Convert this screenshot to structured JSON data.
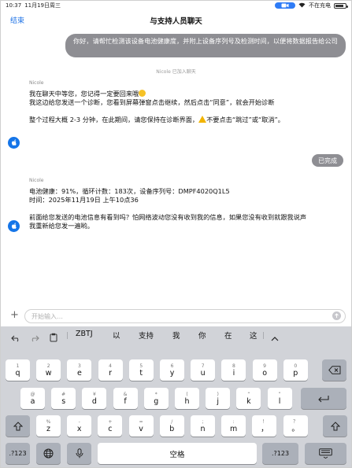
{
  "status_bar": {
    "time": "10:37",
    "date": "11月19日周三",
    "charge_label": "不在充电"
  },
  "header": {
    "end_label": "结束",
    "title": "与支持人员聊天"
  },
  "messages": {
    "user_request": "你好，请帮忙检测该设备电池健康度，并附上设备序列号及检测时间，以便将数据报告给公司",
    "system_note": "Nicole 已加入聊天",
    "agent_name_1": "Nicole",
    "agent_msg_1_line_1_before": "我在聊天中等您，您记得一定要回来哦",
    "agent_msg_1_line_2": "我这边给您发送一个诊断，您看到屏幕弹窗点击继续，然后点击“同意”，就会开始诊断",
    "agent_msg_1_line_3_before": "整个过程大概 2-3 分钟，在此期间，请您保持在诊断界面，",
    "agent_msg_1_line_3_after": "不要点击“跳过”或“取消”。",
    "user_done": "已完成",
    "agent_name_2": "Nicole",
    "agent_msg_2_line_1": "电池健康：91%，循环计数：183次，设备序列号：DMPF4020Q1L5",
    "agent_msg_2_line_2": "时间：2025年11月19日 上午10点36",
    "agent_msg_2_line_3": "前面给您发送的电池信息有看到吗？怕网络波动您没有收到我的信息，如果您没有收到就跟我说声我重新给您发一遍哟。"
  },
  "input": {
    "placeholder": "开始输入…"
  },
  "keyboard": {
    "suggestions": [
      "ZBTJ",
      "以",
      "支持",
      "我",
      "你",
      "在",
      "这"
    ],
    "row1": [
      {
        "main": "q",
        "top": "1"
      },
      {
        "main": "w",
        "top": "2"
      },
      {
        "main": "e",
        "top": "3"
      },
      {
        "main": "r",
        "top": "4"
      },
      {
        "main": "t",
        "top": "5"
      },
      {
        "main": "y",
        "top": "6"
      },
      {
        "main": "u",
        "top": "7"
      },
      {
        "main": "i",
        "top": "8"
      },
      {
        "main": "o",
        "top": "9"
      },
      {
        "main": "p",
        "top": "0"
      }
    ],
    "row2": [
      {
        "main": "a",
        "top": "@"
      },
      {
        "main": "s",
        "top": "#"
      },
      {
        "main": "d",
        "top": "¥"
      },
      {
        "main": "f",
        "top": "&"
      },
      {
        "main": "g",
        "top": "*"
      },
      {
        "main": "h",
        "top": "("
      },
      {
        "main": "j",
        "top": ")"
      },
      {
        "main": "k",
        "top": "“"
      },
      {
        "main": "l",
        "top": "”"
      }
    ],
    "row3": [
      {
        "main": "z",
        "top": "%"
      },
      {
        "main": "x",
        "top": "-"
      },
      {
        "main": "c",
        "top": "+"
      },
      {
        "main": "v",
        "top": "="
      },
      {
        "main": "b",
        "top": "/"
      },
      {
        "main": "n",
        "top": ";"
      },
      {
        "main": "m",
        "top": ":"
      },
      {
        "main": "，",
        "top": "！"
      },
      {
        "main": "。",
        "top": "？"
      }
    ],
    "num_label": ".?123",
    "space_label": "空格"
  },
  "colors": {
    "accent": "#1f73e6",
    "user_bubble": "#8e8e93",
    "keyboard_bg": "#d1d3d8"
  }
}
